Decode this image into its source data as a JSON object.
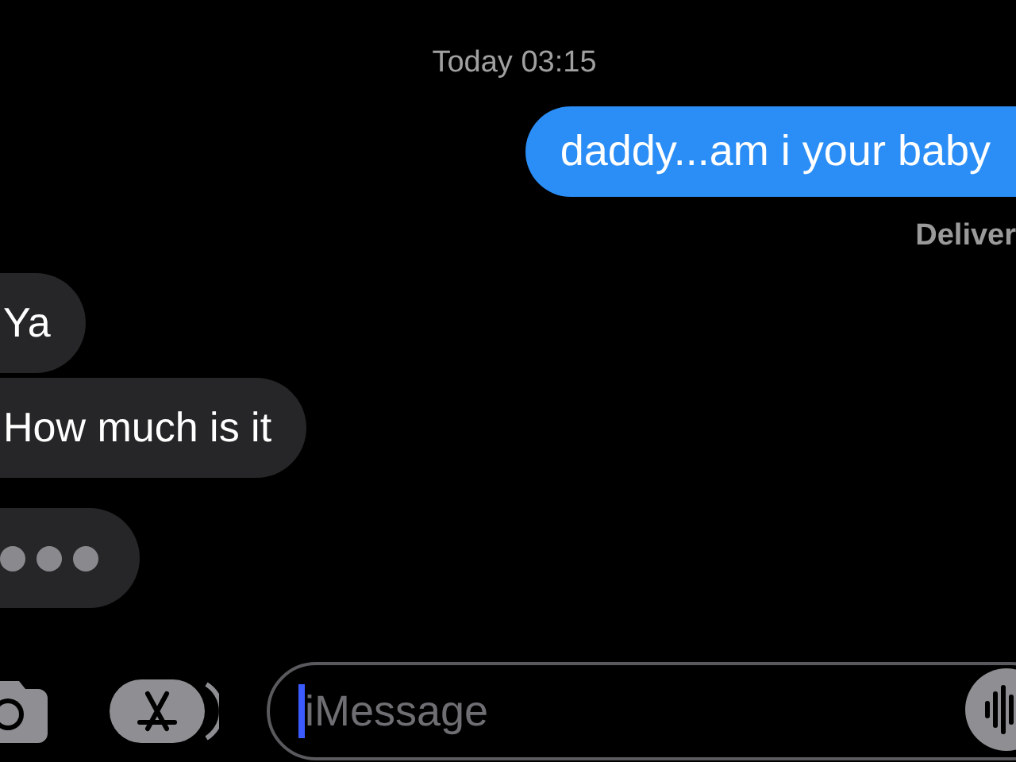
{
  "timestamp": "Today 03:15",
  "messages": [
    {
      "kind": "outgoing",
      "text": "daddy...am i your baby"
    },
    {
      "kind": "status",
      "text": "Deliver"
    },
    {
      "kind": "incoming",
      "text": "Ya"
    },
    {
      "kind": "incoming",
      "text": "How much is it"
    },
    {
      "kind": "typing"
    }
  ],
  "composer": {
    "placeholder": "iMessage"
  }
}
